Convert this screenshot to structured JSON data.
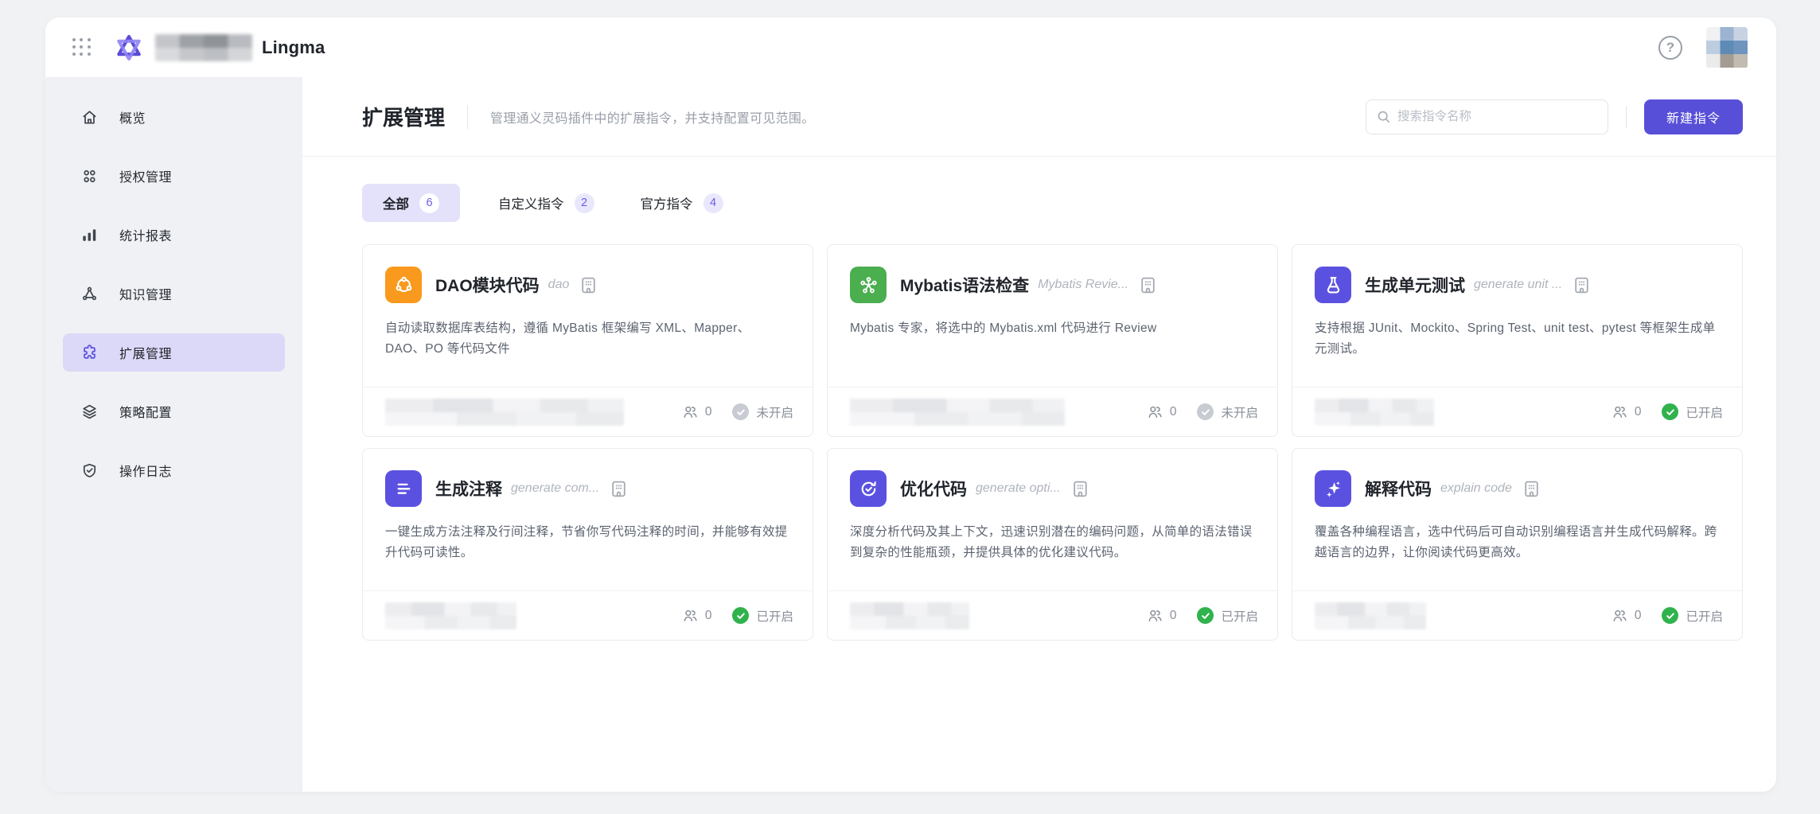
{
  "topbar": {
    "product_name": "Lingma",
    "help_glyph": "?"
  },
  "sidebar": {
    "items": [
      {
        "key": "overview",
        "label": "概览",
        "icon": "home-icon",
        "active": false
      },
      {
        "key": "auth",
        "label": "授权管理",
        "icon": "apps-icon",
        "active": false
      },
      {
        "key": "stats",
        "label": "统计报表",
        "icon": "bar-chart-icon",
        "active": false
      },
      {
        "key": "knowledge",
        "label": "知识管理",
        "icon": "knowledge-icon",
        "active": false
      },
      {
        "key": "extensions",
        "label": "扩展管理",
        "icon": "puzzle-icon",
        "active": true
      },
      {
        "key": "policy",
        "label": "策略配置",
        "icon": "layers-icon",
        "active": false
      },
      {
        "key": "logs",
        "label": "操作日志",
        "icon": "shield-check-icon",
        "active": false
      }
    ]
  },
  "page": {
    "title": "扩展管理",
    "subtitle": "管理通义灵码插件中的扩展指令，并支持配置可见范围。",
    "search_placeholder": "搜索指令名称",
    "new_button_label": "新建指令"
  },
  "tabs": [
    {
      "key": "all",
      "label": "全部",
      "count": "6",
      "active": true
    },
    {
      "key": "custom",
      "label": "自定义指令",
      "count": "2",
      "active": false
    },
    {
      "key": "official",
      "label": "官方指令",
      "count": "4",
      "active": false
    }
  ],
  "cards": [
    {
      "title": "DAO模块代码",
      "subtitle": "dao",
      "description": "自动读取数据库表结构，遵循 MyBatis 框架编写 XML、Mapper、DAO、PO 等代码文件",
      "icon": "share-nodes-icon",
      "icon_color": "#f9991d",
      "users_count": "0",
      "status_label": "未开启",
      "status_state": "off",
      "redacted_width": 300
    },
    {
      "title": "Mybatis语法检查",
      "subtitle": "Mybatis Revie...",
      "description": "Mybatis 专家，将选中的 Mybatis.xml 代码进行 Review",
      "icon": "molecule-icon",
      "icon_color": "#4bae4f",
      "users_count": "0",
      "status_label": "未开启",
      "status_state": "off",
      "redacted_width": 270
    },
    {
      "title": "生成单元测试",
      "subtitle": "generate unit ...",
      "description": "支持根据 JUnit、Mockito、Spring Test、unit test、pytest 等框架生成单元测试。",
      "icon": "flask-icon",
      "icon_color": "#5b51e1",
      "users_count": "0",
      "status_label": "已开启",
      "status_state": "on",
      "redacted_width": 150
    },
    {
      "title": "生成注释",
      "subtitle": "generate com...",
      "description": "一键生成方法注释及行间注释，节省你写代码注释的时间，并能够有效提升代码可读性。",
      "icon": "comment-lines-icon",
      "icon_color": "#5b51e1",
      "users_count": "0",
      "status_label": "已开启",
      "status_state": "on",
      "redacted_width": 165
    },
    {
      "title": "优化代码",
      "subtitle": "generate opti...",
      "description": "深度分析代码及其上下文，迅速识别潜在的编码问题，从简单的语法错误到复杂的性能瓶颈，并提供具体的优化建议代码。",
      "icon": "optimize-icon",
      "icon_color": "#5b51e1",
      "users_count": "0",
      "status_label": "已开启",
      "status_state": "on",
      "redacted_width": 150
    },
    {
      "title": "解释代码",
      "subtitle": "explain code",
      "description": "覆盖各种编程语言，选中代码后可自动识别编程语言并生成代码解释。跨越语言的边界，让你阅读代码更高效。",
      "icon": "sparkles-icon",
      "icon_color": "#5b51e1",
      "users_count": "0",
      "status_label": "已开启",
      "status_state": "on",
      "redacted_width": 140
    }
  ],
  "colors": {
    "accent": "#584fd8",
    "accent_light": "#e4e1fb",
    "sidebar_active_bg": "#dcd8f7",
    "status_on": "#30b24c",
    "status_off": "#c8ccd2"
  }
}
